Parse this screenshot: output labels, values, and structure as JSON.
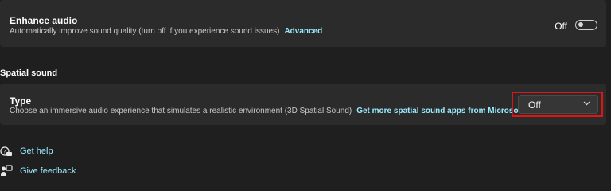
{
  "enhance_audio": {
    "title": "Enhance audio",
    "description": "Automatically improve sound quality (turn off if you experience sound issues)",
    "link": "Advanced",
    "toggle_label": "Off",
    "toggle_on": false
  },
  "spatial_sound": {
    "heading": "Spatial sound",
    "type_title": "Type",
    "type_description": "Choose an immersive audio experience that simulates a realistic environment (3D Spatial Sound)",
    "type_link": "Get more spatial sound apps from Microsoft Store",
    "dropdown_value": "Off",
    "highlight_color": "#e01414"
  },
  "footer_links": {
    "help": "Get help",
    "feedback": "Give feedback"
  },
  "icons": {
    "toggle": "toggle-switch-icon",
    "chevron": "chevron-down-icon",
    "help": "get-help-icon",
    "feedback": "feedback-icon"
  },
  "colors": {
    "background": "#1f1f1f",
    "card": "#2b2b2b",
    "accent_link": "#99ebff"
  }
}
